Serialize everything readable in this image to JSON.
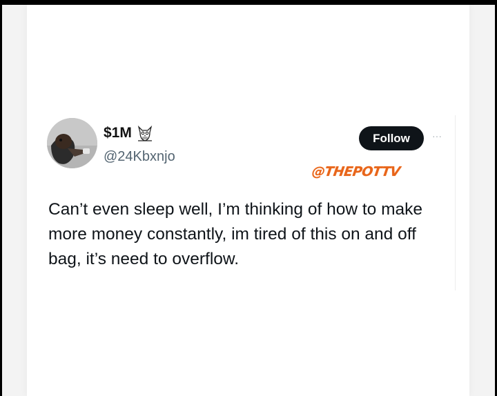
{
  "tweet": {
    "author": {
      "display_name": "$1M",
      "handle": "@24Kbxnjo",
      "badge_icon": "owl-icon",
      "avatar_icon": "avatar"
    },
    "follow_label": "Follow",
    "more_icon": "more-icon",
    "more_glyph": "···",
    "text": "Can’t even sleep well, I’m thinking of how to make more money constantly, im tired of this on and off bag, it’s need to overflow."
  },
  "watermark": {
    "text": "@THEPOTTV",
    "color": "#e8651a"
  },
  "colors": {
    "follow_button_bg": "#0f1419",
    "handle_gray": "#536471",
    "text": "#0f1419"
  }
}
